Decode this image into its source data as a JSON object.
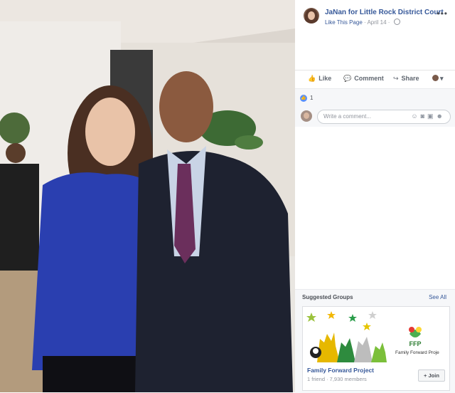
{
  "post": {
    "page_name": "JaNan for Little Rock District Court",
    "like_page_link": "Like This Page",
    "separator": " · ",
    "date": "April 14",
    "separator2": " · "
  },
  "actions": {
    "like_label": "Like",
    "comment_label": "Comment",
    "share_label": "Share"
  },
  "reactions": {
    "count": "1"
  },
  "comment_input": {
    "placeholder": "Write a comment..."
  },
  "suggested_groups": {
    "title": "Suggested Groups",
    "see_all_label": "See All",
    "group": {
      "name": "Family Forward Project",
      "meta": "1 friend · 7,930 members",
      "join_label": "+ Join",
      "image_badge": "FFP",
      "image_caption": "Family Forward Proje"
    }
  },
  "icons": {
    "more": "more-dots-icon",
    "globe": "globe-icon",
    "like": "thumbs-up-icon",
    "comment": "comment-icon",
    "share": "share-icon",
    "emoji": "emoji-icon",
    "camera": "camera-icon",
    "gif": "gif-icon",
    "sticker": "sticker-icon"
  },
  "colors": {
    "link_blue": "#365899",
    "reaction_blue": "#5890ff",
    "panel_gray": "#f6f7f9"
  }
}
